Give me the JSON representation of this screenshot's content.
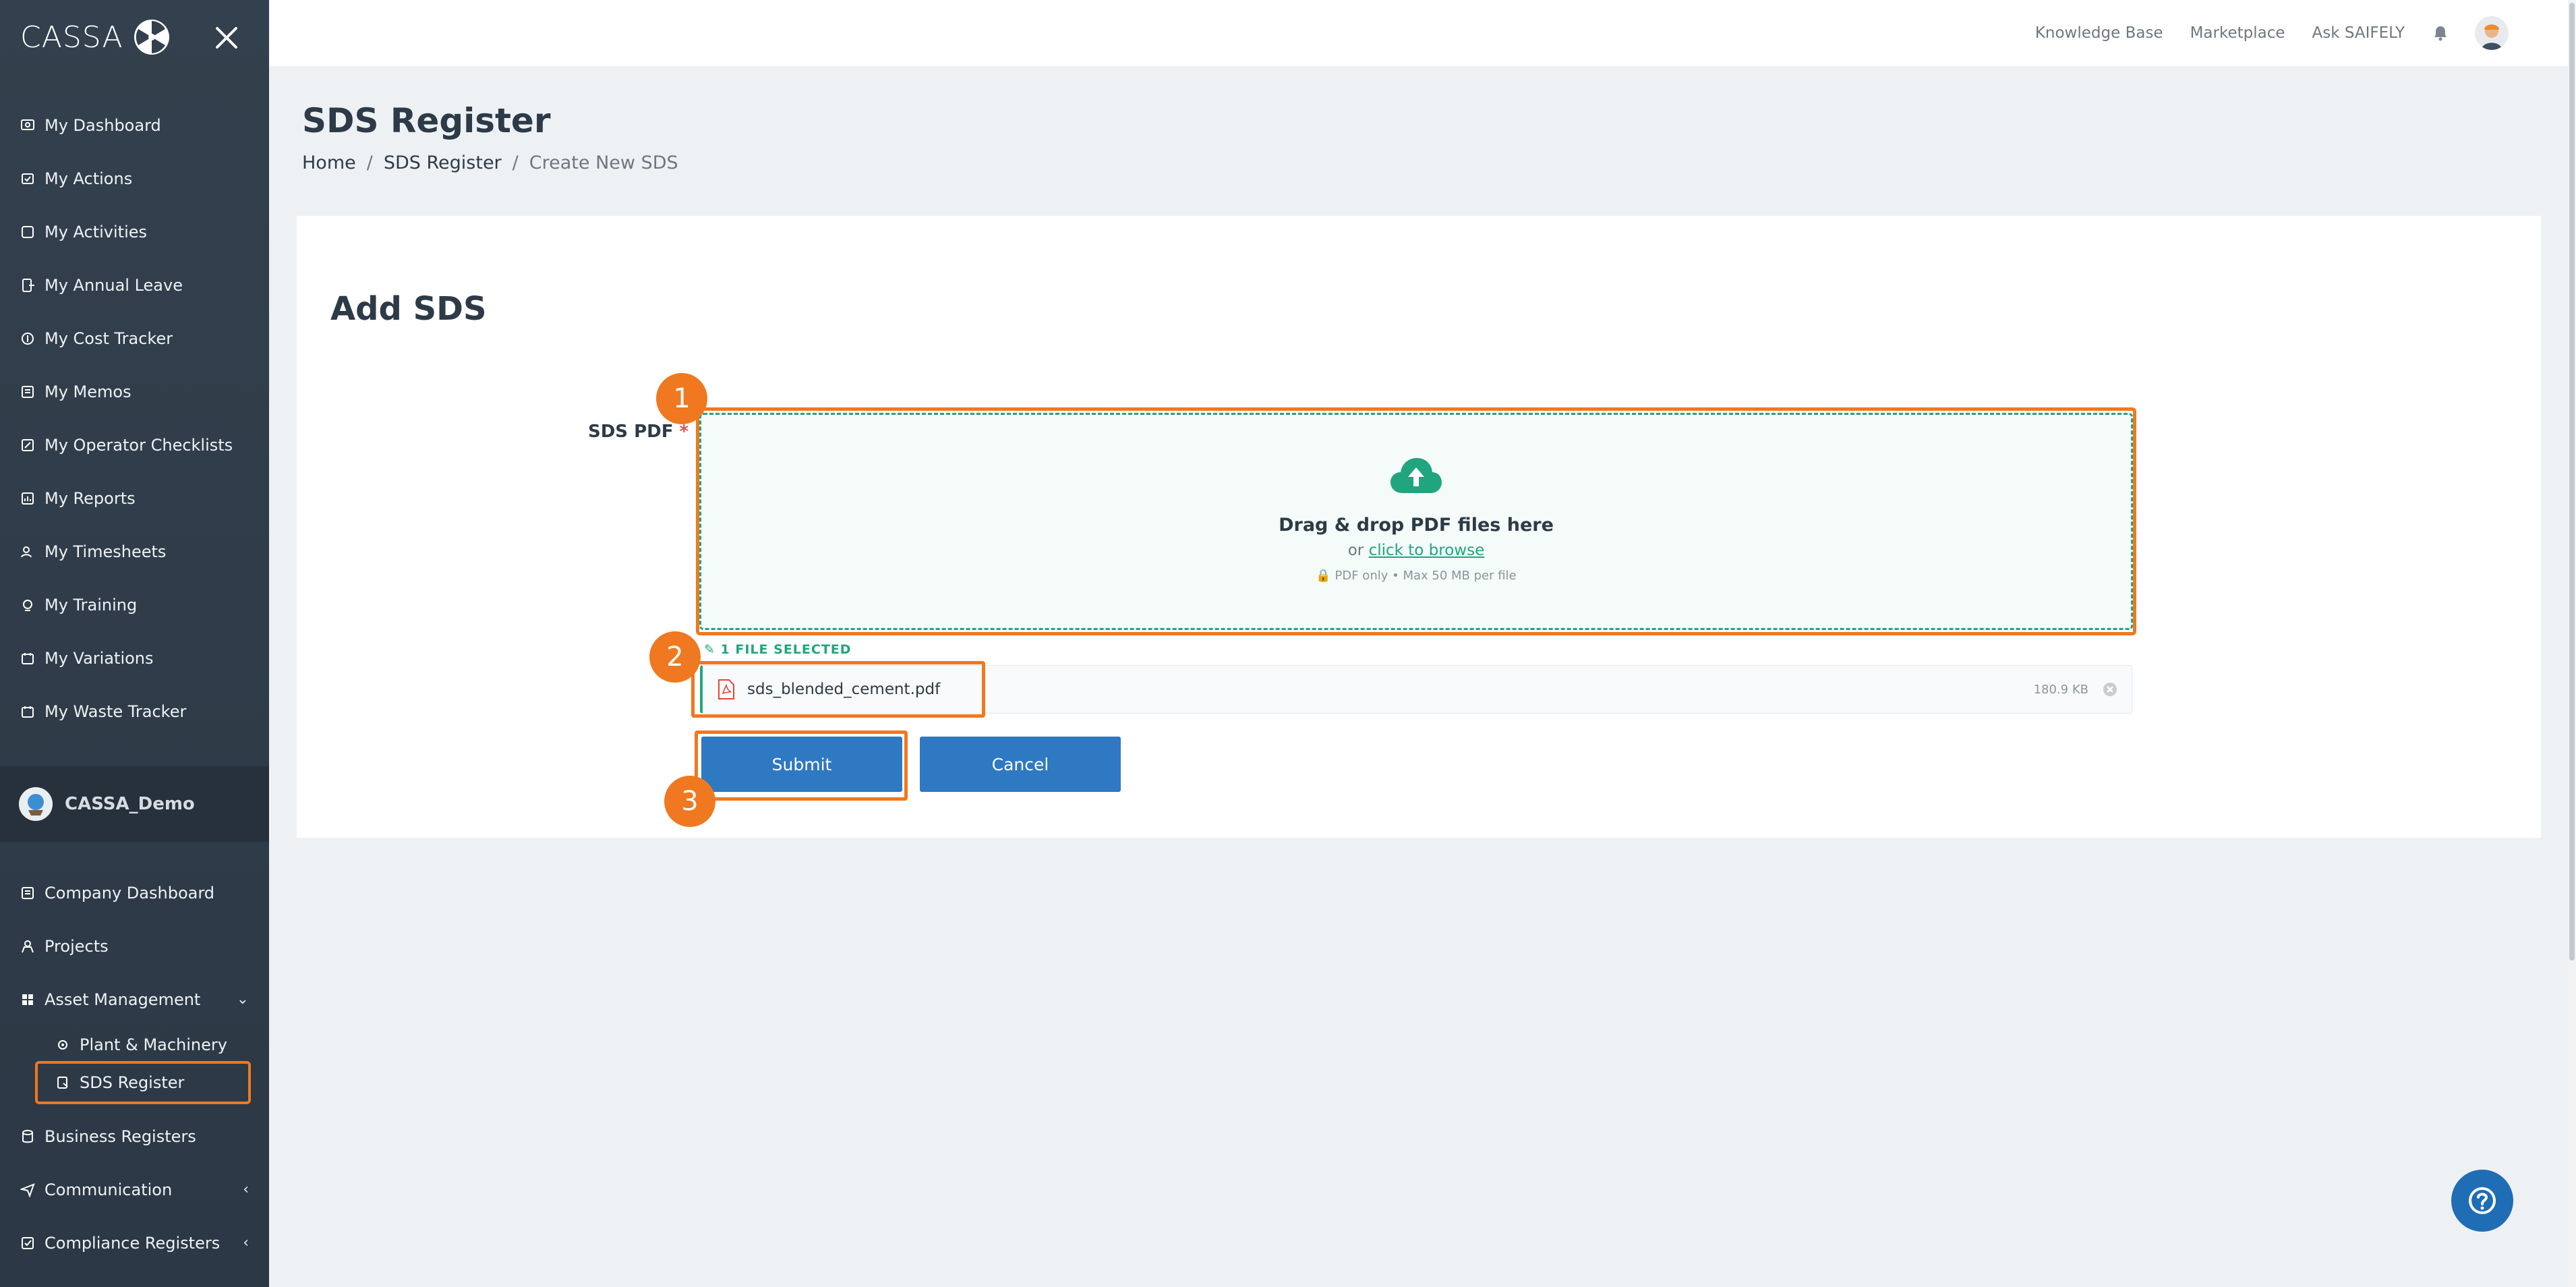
{
  "app": {
    "logo_text": "CASSA"
  },
  "sidebar": {
    "items": [
      {
        "label": "My Dashboard",
        "icon": "dashboard-icon"
      },
      {
        "label": "My Actions",
        "icon": "actions-icon"
      },
      {
        "label": "My Activities",
        "icon": "activities-icon"
      },
      {
        "label": "My Annual Leave",
        "icon": "leave-icon"
      },
      {
        "label": "My Cost Tracker",
        "icon": "cost-icon"
      },
      {
        "label": "My Memos",
        "icon": "memo-icon"
      },
      {
        "label": "My Operator Checklists",
        "icon": "checklist-icon"
      },
      {
        "label": "My Reports",
        "icon": "reports-icon"
      },
      {
        "label": "My Timesheets",
        "icon": "timesheet-icon"
      },
      {
        "label": "My Training",
        "icon": "training-icon"
      },
      {
        "label": "My Variations",
        "icon": "variations-icon"
      },
      {
        "label": "My Waste Tracker",
        "icon": "waste-icon"
      }
    ],
    "company": "CASSA_Demo",
    "lower": {
      "company_dashboard": "Company Dashboard",
      "projects": "Projects",
      "asset_management": "Asset Management",
      "plant_machinery": "Plant & Machinery",
      "sds_register": "SDS Register",
      "business_registers": "Business Registers",
      "communication": "Communication",
      "compliance_registers": "Compliance Registers"
    }
  },
  "topbar": {
    "links": [
      "Knowledge Base",
      "Marketplace",
      "Ask SAIFELY"
    ]
  },
  "page": {
    "title": "SDS Register",
    "breadcrumb": [
      "Home",
      "SDS Register",
      "Create New SDS"
    ],
    "sep": "/"
  },
  "form": {
    "heading": "Add SDS",
    "field_label": "SDS PDF",
    "required_mark": "*",
    "dropzone": {
      "title": "Drag & drop PDF files here",
      "or_text": "or",
      "browse_link": "click to browse",
      "meta": "PDF only  •  Max 50 MB per file"
    },
    "files_selected": "1 FILE SELECTED",
    "file": {
      "name": "sds_blended_cement.pdf",
      "size": "180.9 KB"
    },
    "submit": "Submit",
    "cancel": "Cancel"
  },
  "annotations": {
    "badge1": "1",
    "badge2": "2",
    "badge3": "3"
  },
  "colors": {
    "sidebar": "#33404d",
    "accent": "#21a57f",
    "button": "#2f78c2",
    "highlight": "#f07820"
  }
}
